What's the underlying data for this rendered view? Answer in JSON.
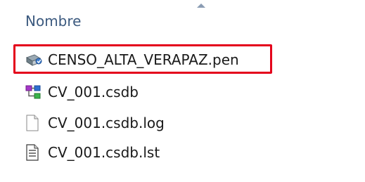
{
  "explorer": {
    "column_header": "Nombre",
    "sort_direction": "ascending",
    "files": [
      {
        "name": "CENSO_ALTA_VERAPAZ.pen",
        "icon": "pen-file-icon",
        "highlighted": true
      },
      {
        "name": "CV_001.csdb",
        "icon": "csdb-file-icon",
        "highlighted": false
      },
      {
        "name": "CV_001.csdb.log",
        "icon": "text-file-icon",
        "highlighted": false
      },
      {
        "name": "CV_001.csdb.lst",
        "icon": "document-file-icon",
        "highlighted": false
      }
    ],
    "highlight_color": "#e4001b",
    "header_color": "#3c5a7f"
  }
}
